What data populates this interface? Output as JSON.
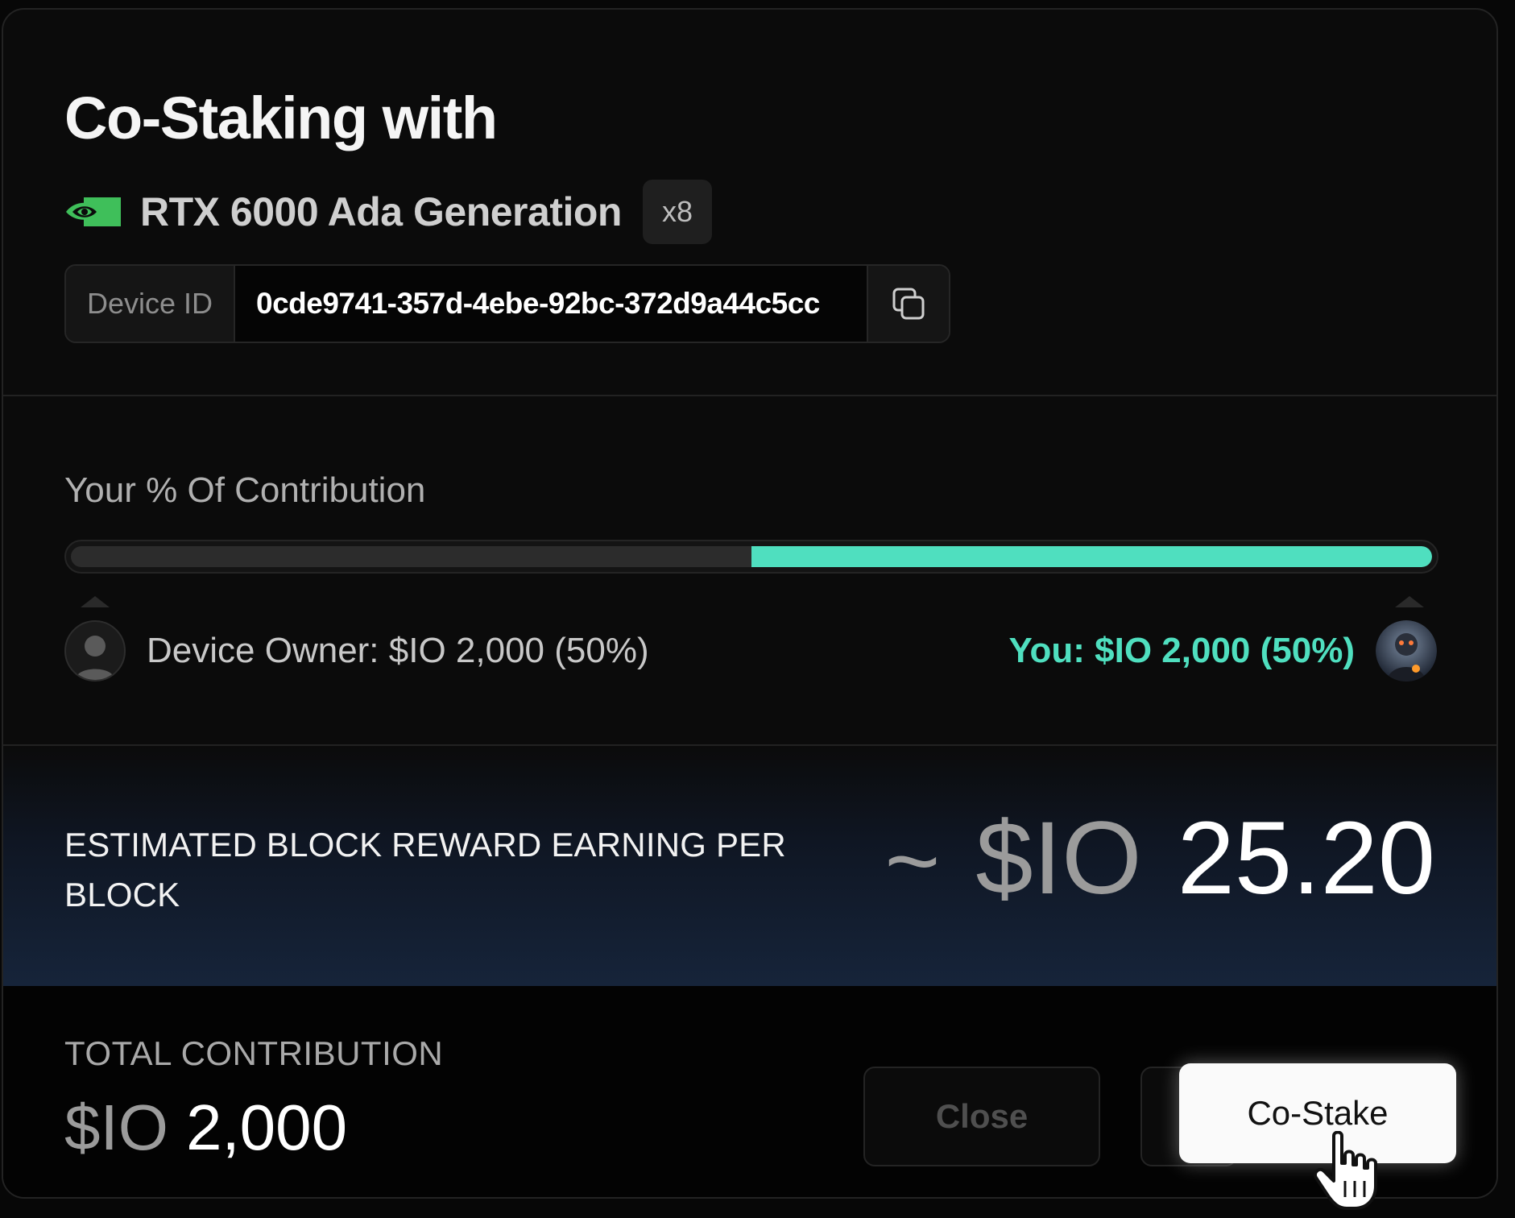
{
  "modal": {
    "title": "Co-Staking with",
    "gpu": {
      "brand_icon": "nvidia-logo-icon",
      "name": "RTX 6000 Ada Generation",
      "count": "x8"
    },
    "device": {
      "label": "Device ID",
      "value": "0cde9741-357d-4ebe-92bc-372d9a44c5cc",
      "copy_icon": "copy-icon"
    }
  },
  "contribution": {
    "label": "Your % Of Contribution",
    "your_share_fraction": 0.5,
    "owner_text": "Device Owner: $IO 2,000 (50%)",
    "you_text": "You: $IO 2,000 (50%)",
    "accent_color": "#4fdfbf"
  },
  "reward": {
    "label": "ESTIMATED BLOCK REWARD EARNING PER BLOCK",
    "tilde": "~",
    "unit": "$IO",
    "value": "25.20"
  },
  "footer": {
    "total_label": "TOTAL CONTRIBUTION",
    "total_unit": "$IO",
    "total_value": "2,000",
    "close_label": "Close",
    "costake_label": "Co-Stake"
  }
}
